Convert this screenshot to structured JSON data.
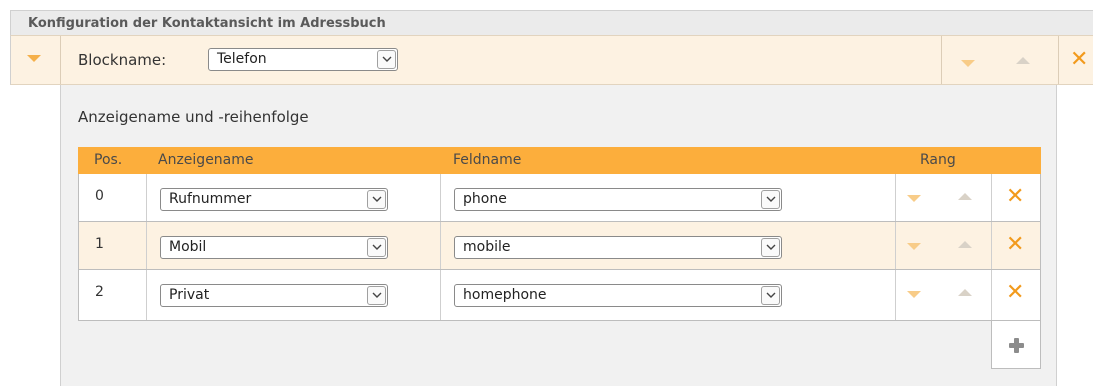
{
  "panel": {
    "title": "Konfiguration der Kontaktansicht im Adressbuch"
  },
  "block": {
    "label": "Blockname:",
    "value": "Telefon"
  },
  "section": {
    "subtitle": "Anzeigename und -reihenfolge"
  },
  "table": {
    "headers": {
      "pos": "Pos.",
      "display_name": "Anzeigename",
      "field_name": "Feldname",
      "rank": "Rang"
    },
    "rows": [
      {
        "pos": "0",
        "display_name": "Rufnummer",
        "field_name": "phone"
      },
      {
        "pos": "1",
        "display_name": "Mobil",
        "field_name": "mobile"
      },
      {
        "pos": "2",
        "display_name": "Privat",
        "field_name": "homephone"
      }
    ]
  },
  "colors": {
    "accent": "#fcae3c",
    "icon_orange": "#f29a1c",
    "highlight_row": "#fdf2e2"
  },
  "icons": [
    "chevron-down-icon",
    "move-down-icon",
    "move-up-icon",
    "delete-icon",
    "add-icon"
  ]
}
